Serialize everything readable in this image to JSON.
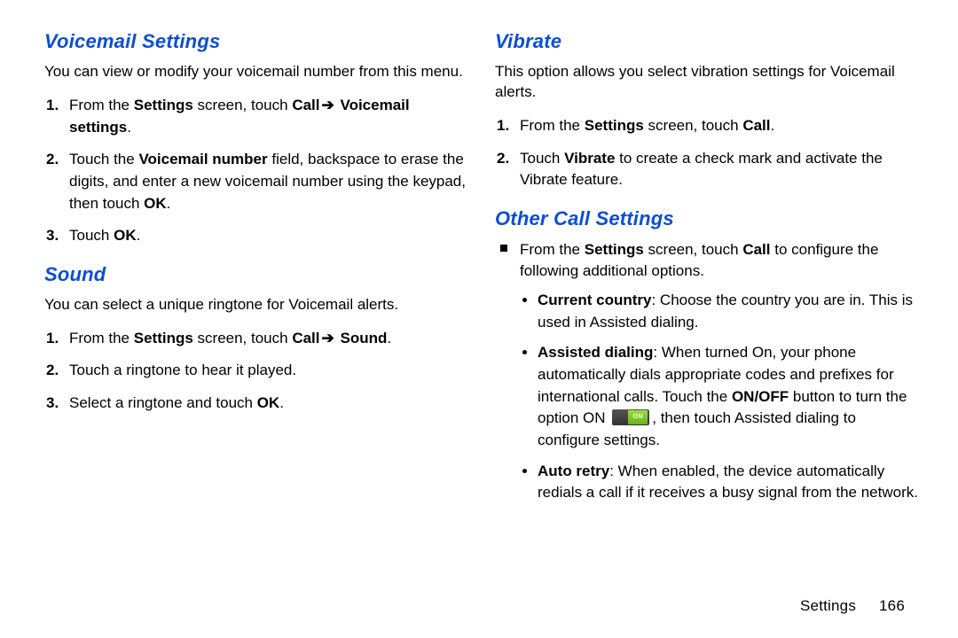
{
  "left": {
    "voicemail": {
      "heading": "Voicemail Settings",
      "intro": "You can view or modify your voicemail number from this menu.",
      "step1_a": "From the ",
      "step1_b": "Settings",
      "step1_c": " screen, touch ",
      "step1_d": "Call",
      "step1_f": "Voicemail settings",
      "step1_g": ".",
      "step2_a": "Touch the ",
      "step2_b": "Voicemail number",
      "step2_c": " field, backspace to erase the digits, and enter a new voicemail number using the keypad, then touch ",
      "step2_d": "OK",
      "step2_e": ".",
      "step3_a": "Touch ",
      "step3_b": "OK",
      "step3_c": "."
    },
    "sound": {
      "heading": "Sound",
      "intro": "You can select a unique ringtone for Voicemail alerts.",
      "step1_a": "From the ",
      "step1_b": "Settings",
      "step1_c": " screen, touch ",
      "step1_d": "Call",
      "step1_f": "Sound",
      "step1_g": ".",
      "step2": "Touch a ringtone to hear it played.",
      "step3_a": " Select a ringtone and touch ",
      "step3_b": "OK",
      "step3_c": "."
    }
  },
  "right": {
    "vibrate": {
      "heading": "Vibrate",
      "intro": "This option allows you select vibration settings for Voicemail alerts.",
      "step1_a": "From the ",
      "step1_b": "Settings",
      "step1_c": " screen, touch ",
      "step1_d": "Call",
      "step1_e": ".",
      "step2_a": "Touch ",
      "step2_b": "Vibrate",
      "step2_c": " to create a check mark and activate the Vibrate feature."
    },
    "other": {
      "heading": "Other Call Settings",
      "lead_a": "From the ",
      "lead_b": "Settings",
      "lead_c": " screen, touch ",
      "lead_d": "Call",
      "lead_e": " to configure the following additional options.",
      "b1_a": "Current country",
      "b1_b": ": Choose the country you are in. This is used in Assisted dialing.",
      "b2_a": "Assisted dialing",
      "b2_b": ": When turned On, your phone automatically dials appropriate codes and prefixes for international calls. Touch the ",
      "b2_c": "ON/OFF",
      "b2_d": " button to turn the option ON ",
      "badge": "ON",
      "b2_e": ", then touch Assisted dialing to configure settings.",
      "b3_a": "Auto retry",
      "b3_b": ": When enabled, the device automatically redials a call if it receives a busy signal from the network."
    }
  },
  "arrow": "➔",
  "footer": {
    "label": "Settings",
    "page": "166"
  }
}
